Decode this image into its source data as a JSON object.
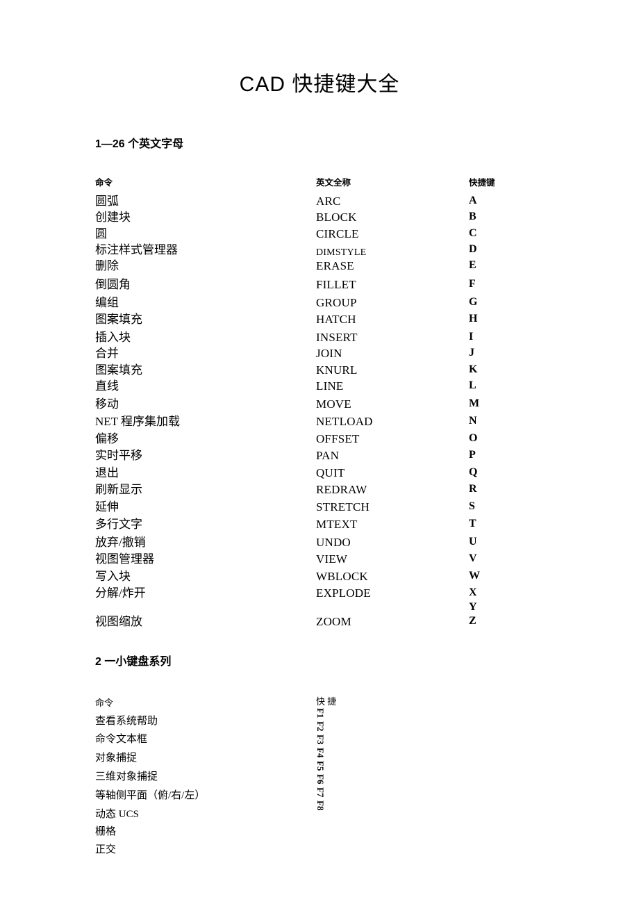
{
  "document": {
    "title": "CAD 快捷键大全"
  },
  "sections": [
    {
      "heading": "1—26 个英文字母",
      "table": {
        "headers": {
          "command": "命令",
          "english": "英文全称",
          "shortcut": "快捷键"
        },
        "rows": [
          {
            "command": "圆弧",
            "english": "ARC",
            "shortcut": "A"
          },
          {
            "command": "创建块",
            "english": "BLOCK",
            "shortcut": "B"
          },
          {
            "command": "圆",
            "english": "CIRCLE",
            "shortcut": "C"
          },
          {
            "command": "标注样式管理器",
            "english": "DIMSTYLE",
            "shortcut": "D"
          },
          {
            "command": "删除",
            "english": "ERASE",
            "shortcut": "E"
          },
          {
            "command": "倒圆角",
            "english": "FILLET",
            "shortcut": "F"
          },
          {
            "command": "编组",
            "english": "GROUP",
            "shortcut": "G"
          },
          {
            "command": "图案填充",
            "english": "HATCH",
            "shortcut": "H"
          },
          {
            "command": "插入块",
            "english": "INSERT",
            "shortcut": "I"
          },
          {
            "command": "合并",
            "english": "JOIN",
            "shortcut": "J"
          },
          {
            "command": "图案填充",
            "english": "KNURL",
            "shortcut": "K"
          },
          {
            "command": "直线",
            "english": "LINE",
            "shortcut": "L"
          },
          {
            "command": "移动",
            "english": "MOVE",
            "shortcut": "M"
          },
          {
            "command": "NET 程序集加载",
            "english": "NETLOAD",
            "shortcut": "N"
          },
          {
            "command": "偏移",
            "english": "OFFSET",
            "shortcut": "O"
          },
          {
            "command": "实时平移",
            "english": "PAN",
            "shortcut": "P"
          },
          {
            "command": "退出",
            "english": "QUIT",
            "shortcut": "Q"
          },
          {
            "command": "刷新显示",
            "english": "REDRAW",
            "shortcut": "R"
          },
          {
            "command": "延伸",
            "english": "STRETCH",
            "shortcut": "S"
          },
          {
            "command": "多行文字",
            "english": "MTEXT",
            "shortcut": "T"
          },
          {
            "command": "放弃/撤销",
            "english": "UNDO",
            "shortcut": "U"
          },
          {
            "command": "视图管理器",
            "english": "VIEW",
            "shortcut": "V"
          },
          {
            "command": "写入块",
            "english": "WBLOCK",
            "shortcut": "W"
          },
          {
            "command": "分解/炸开",
            "english": "EXPLODE",
            "shortcut": "X"
          },
          {
            "command": "",
            "english": "",
            "shortcut": "Y"
          },
          {
            "command": "视图缩放",
            "english": "ZOOM",
            "shortcut": "Z"
          }
        ]
      }
    },
    {
      "heading": "2 一小键盘系列",
      "table": {
        "headers": {
          "command": "命令",
          "shortcut": "快 捷"
        },
        "rows": [
          {
            "command": "查看系统帮助",
            "shortcut": "F1"
          },
          {
            "command": "命令文本框",
            "shortcut": "F2"
          },
          {
            "command": "对象捕捉",
            "shortcut": "F3"
          },
          {
            "command": "三维对象捕捉",
            "shortcut": "F4"
          },
          {
            "command": "等轴侧平面（俯/右/左）",
            "shortcut": "F5"
          },
          {
            "command": "动态 UCS",
            "shortcut": "F6"
          },
          {
            "command": "栅格",
            "shortcut": "F7"
          },
          {
            "command": "正交",
            "shortcut": "F8"
          }
        ]
      }
    }
  ]
}
